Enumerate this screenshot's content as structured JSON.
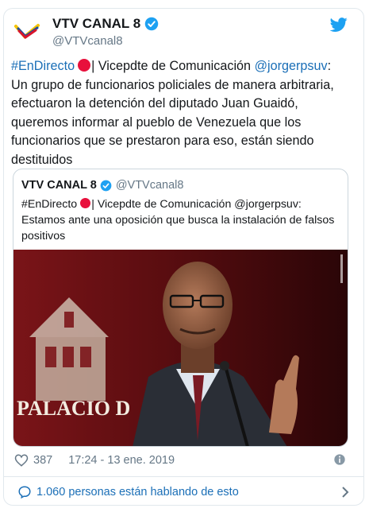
{
  "tweet": {
    "author_name": "VTV CANAL 8",
    "author_handle": "@VTVcanal8",
    "hashtag": "#EnDirecto",
    "text_pre_mention": "| Vicepdte de Comunicación ",
    "mention": "@jorgerpsuv",
    "text_rest": ": Un grupo de funcionarios policiales de manera arbitraria, efectuaron la detención del diputado Juan Guaidó, queremos informar al pueblo de  Venezuela que los funcionarios que se prestaron para eso, están siendo destituidos"
  },
  "quote": {
    "author_name": "VTV CANAL 8",
    "author_handle": "@VTVcanal8",
    "hashtag": "#EnDirecto",
    "text_rest": "| Vicepdte de Comunicación @jorgerpsuv: Estamos ante una oposición que busca la instalación de falsos positivos",
    "photo_sign_text": "PALACIO D"
  },
  "footer": {
    "likes": "387",
    "timestamp": "17:24 - 13 ene. 2019"
  },
  "conversation": {
    "label": "1.060 personas están hablando de esto"
  },
  "icons": {
    "verified": "verified-badge-icon",
    "bird": "twitter-bird-icon",
    "heart": "heart-icon",
    "info": "info-icon",
    "bubble": "reply-bubble-icon",
    "chevron": "chevron-right-icon"
  },
  "colors": {
    "link": "#1b6fb7",
    "twitter_blue": "#1da1f2",
    "live_dot": "#e8103c",
    "muted": "#657786"
  }
}
